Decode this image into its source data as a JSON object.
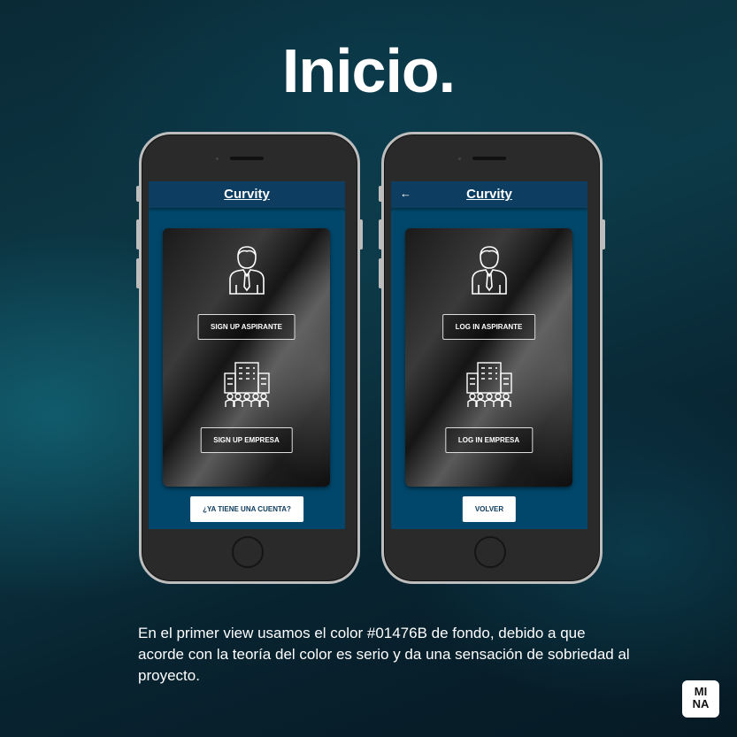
{
  "title": "Inicio.",
  "screens": [
    {
      "brand": "Curvity",
      "primary_button": "SIGN UP ASPIRANTE",
      "secondary_button": "SIGN UP EMPRESA",
      "footer_button": "¿YA TIENE UNA CUENTA?"
    },
    {
      "brand": "Curvity",
      "back_icon": "←",
      "primary_button": "LOG IN ASPIRANTE",
      "secondary_button": "LOG IN EMPRESA",
      "footer_button": "VOLVER"
    }
  ],
  "caption": "En el primer view usamos el color #01476B de fondo, debido a que acorde con la teoría del color es serio y da una sensación de sobriedad al proyecto.",
  "logo": {
    "line1": "MI",
    "line2": "NA"
  },
  "colors": {
    "app_background": "#01476B",
    "appbar": "#0d3d60"
  }
}
